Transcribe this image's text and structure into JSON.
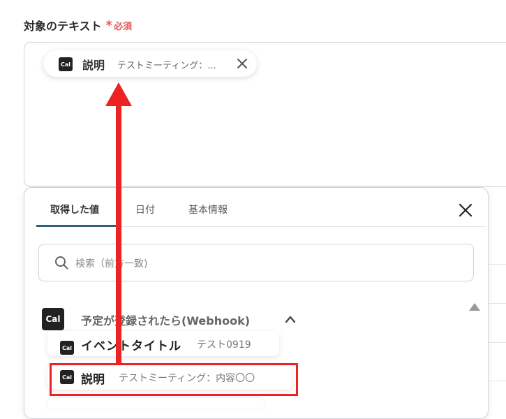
{
  "field": {
    "label": "対象のテキスト",
    "required_star": "*",
    "required_text": "必須"
  },
  "chip": {
    "logo": "Cal",
    "label": "説明",
    "value": "テストミーティング：...",
    "close_icon": "close-icon"
  },
  "panel": {
    "tabs": [
      {
        "label": "取得した値",
        "active": true
      },
      {
        "label": "日付",
        "active": false
      },
      {
        "label": "基本情報",
        "active": false
      }
    ],
    "close_icon": "close-icon",
    "search": {
      "icon": "search-icon",
      "placeholder": "検索（前方一致)"
    },
    "group": {
      "logo": "Cal",
      "title": "予定が登録されたら(Webhook)",
      "chevron_icon": "chevron-up-icon"
    },
    "items": [
      {
        "logo": "Cal",
        "label": "イベントタイトル",
        "value": "テスト0919"
      },
      {
        "logo": "Cal",
        "label": "説明",
        "value": "テストミーティング：内容〇〇"
      }
    ]
  },
  "annotation": {
    "highlight_color": "#ee2222",
    "arrow_color": "#ee2222"
  },
  "colors": {
    "required": "#e8565b",
    "tab_underline": "#2f5f7a",
    "border": "#cfd3d8"
  }
}
